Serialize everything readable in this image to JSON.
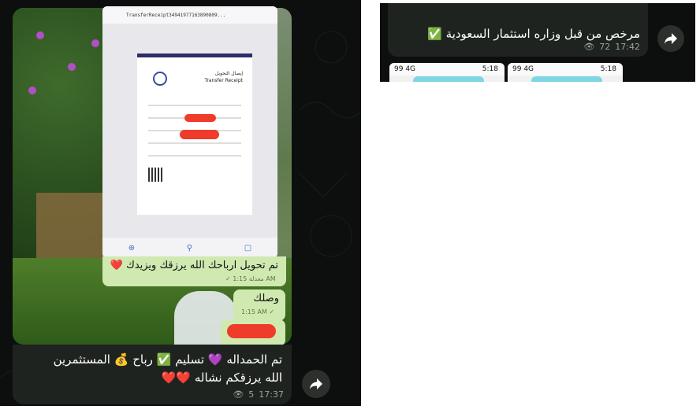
{
  "left": {
    "receipt": {
      "url": "TransferReceipt34941977163890809...",
      "title_ar": "إيصال التحويل",
      "title_en": "Transfer Receipt"
    },
    "caption1": {
      "text": "تم تحويل ارباحك الله يرزقك ويزيدك ❤️",
      "meta": "✓ معدلة 1:15 AM"
    },
    "wasal": {
      "text": "وصلك",
      "meta": "1:15 AM ✓"
    },
    "message": {
      "line1": "تم الحمداله 💜 تسليم ✅ رباح 💰 المستثمرين",
      "line2": "الله  يرزقكم نشاله ❤️❤️",
      "views": "5",
      "time": "17:37"
    }
  },
  "right": {
    "message": {
      "text": "مرخص من قبل وزاره استثمار السعودية ✅",
      "views": "72",
      "time": "17:42"
    },
    "thumbs": [
      {
        "carrier": "99 4G",
        "time": "5:18"
      },
      {
        "carrier": "99 4G",
        "time": "5:18"
      }
    ]
  },
  "colors": {
    "bubble_dark": "#1f2320",
    "bubble_green": "#cfe9b0",
    "bg_dark": "#0c0f0d"
  },
  "icons": {
    "share": "share-icon",
    "eye": "eye-icon",
    "check": "double-check-icon"
  }
}
